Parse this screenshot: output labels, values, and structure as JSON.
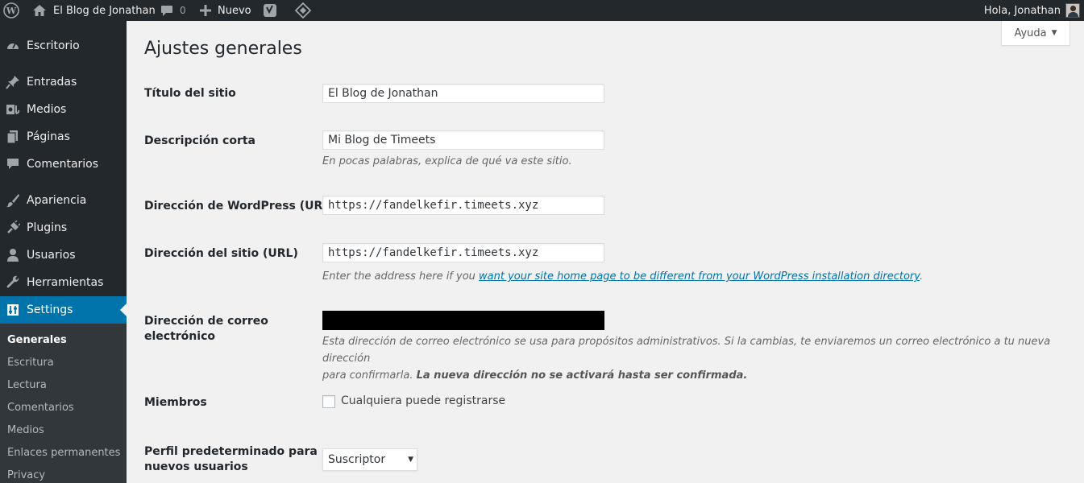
{
  "adminbar": {
    "site_name": "El Blog de Jonathan",
    "comments_count": "0",
    "new_label": "Nuevo",
    "greeting": "Hola, Jonathan"
  },
  "sidebar": {
    "items": [
      {
        "label": "Escritorio",
        "icon": "dashboard-icon"
      },
      {
        "label": "Entradas",
        "icon": "pin-icon"
      },
      {
        "label": "Medios",
        "icon": "media-icon"
      },
      {
        "label": "Páginas",
        "icon": "pages-icon"
      },
      {
        "label": "Comentarios",
        "icon": "comments-icon"
      },
      {
        "label": "Apariencia",
        "icon": "brush-icon"
      },
      {
        "label": "Plugins",
        "icon": "plugin-icon"
      },
      {
        "label": "Usuarios",
        "icon": "users-icon"
      },
      {
        "label": "Herramientas",
        "icon": "wrench-icon"
      },
      {
        "label": "Settings",
        "icon": "settings-icon",
        "current": true
      }
    ],
    "submenu": [
      "Generales",
      "Escritura",
      "Lectura",
      "Comentarios",
      "Medios",
      "Enlaces permanentes",
      "Privacy"
    ]
  },
  "help_tab": {
    "label": "Ayuda"
  },
  "page": {
    "title": "Ajustes generales",
    "site_title": {
      "label": "Título del sitio",
      "value": "El Blog de Jonathan"
    },
    "tagline": {
      "label": "Descripción corta",
      "value": "Mi Blog de Timeets",
      "description": "En pocas palabras, explica de qué va este sitio."
    },
    "wp_url": {
      "label": "Dirección de WordPress (URL)",
      "value": "https://fandelkefir.timeets.xyz"
    },
    "site_url": {
      "label": "Dirección del sitio (URL)",
      "value": "https://fandelkefir.timeets.xyz",
      "description_pre": "Enter the address here if you ",
      "description_link": "want your site home page to be different from your WordPress installation directory",
      "description_post": "."
    },
    "email": {
      "label_line1": "Dirección de correo",
      "label_line2": "electrónico",
      "value": "",
      "description_line1": "Esta dirección de correo electrónico se usa para propósitos administrativos. Si la cambias, te enviaremos un correo electrónico a tu nueva dirección",
      "description_line2_pre": "para confirmarla. ",
      "description_line2_bold": "La nueva dirección no se activará hasta ser confirmada."
    },
    "membership": {
      "label": "Miembros",
      "checkbox_label": "Cualquiera puede registrarse",
      "checked": false
    },
    "default_role": {
      "label_line1": "Perfil predeterminado para",
      "label_line2": "nuevos usuarios",
      "value": "Suscriptor"
    }
  },
  "colors": {
    "adminbar_bg": "#23282d",
    "sidebar_bg": "#23282d",
    "submenu_bg": "#32373c",
    "accent": "#0073aa",
    "content_bg": "#f1f1f1"
  }
}
